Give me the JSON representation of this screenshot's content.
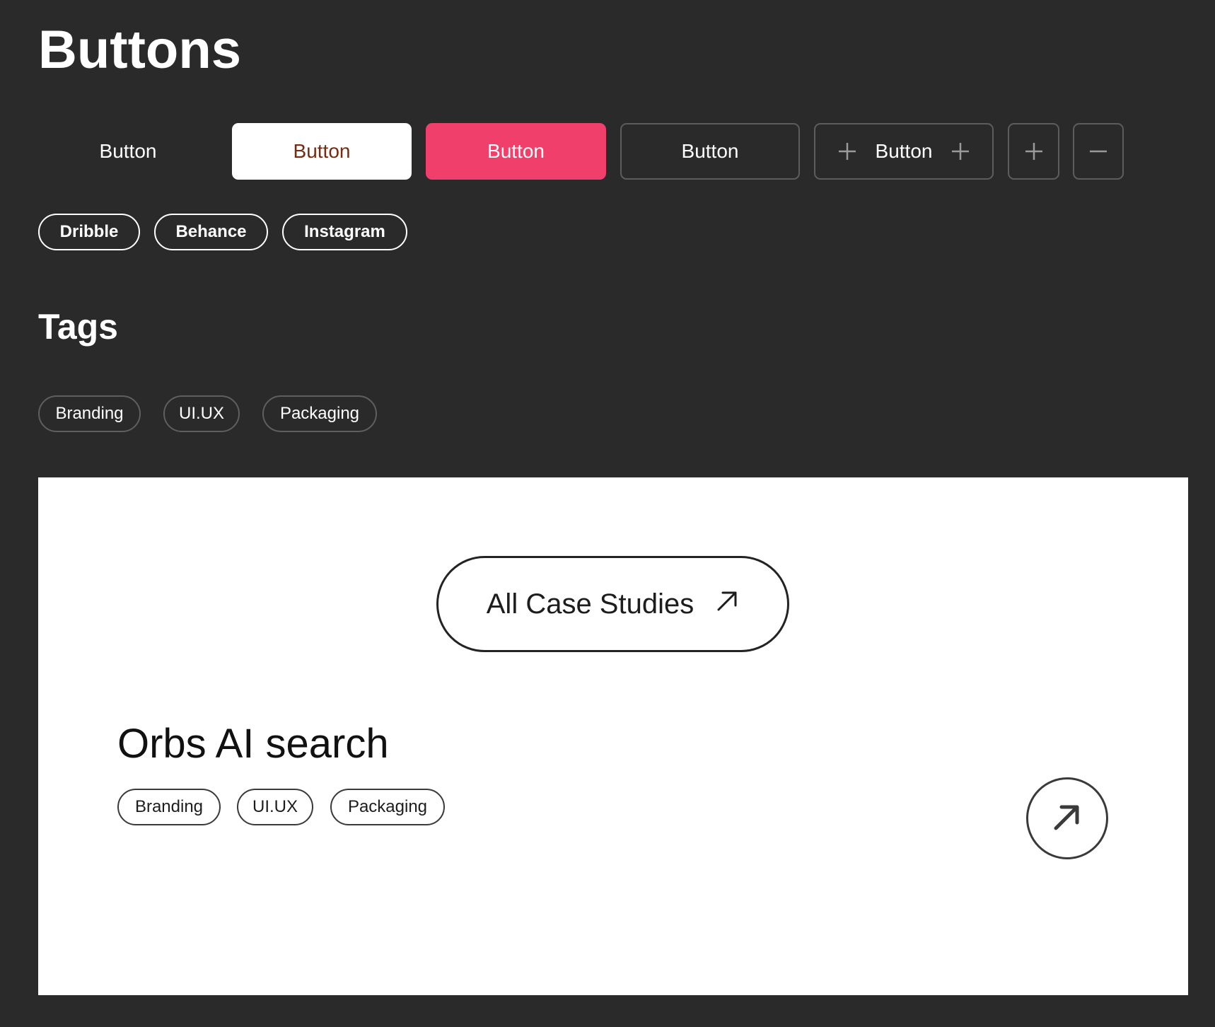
{
  "headings": {
    "buttons": "Buttons",
    "tags": "Tags"
  },
  "buttons": {
    "ghost": "Button",
    "white": "Button",
    "pink": "Button",
    "outline": "Button",
    "with_icons": "Button"
  },
  "social": {
    "dribble": "Dribble",
    "behance": "Behance",
    "instagram": "Instagram"
  },
  "tags_dark": [
    "Branding",
    "UI.UX",
    "Packaging"
  ],
  "card": {
    "cta_label": "All Case Studies",
    "project_title": "Orbs AI search",
    "tags": [
      "Branding",
      "UI.UX",
      "Packaging"
    ]
  },
  "icons": {
    "plus": "plus-icon",
    "minus": "minus-icon",
    "arrow": "arrow-up-right-icon"
  },
  "colors": {
    "background": "#2a2a2b",
    "accent_pink": "#f13f6b",
    "white_button_text": "#7a2a0e",
    "card_background": "#ffffff"
  }
}
